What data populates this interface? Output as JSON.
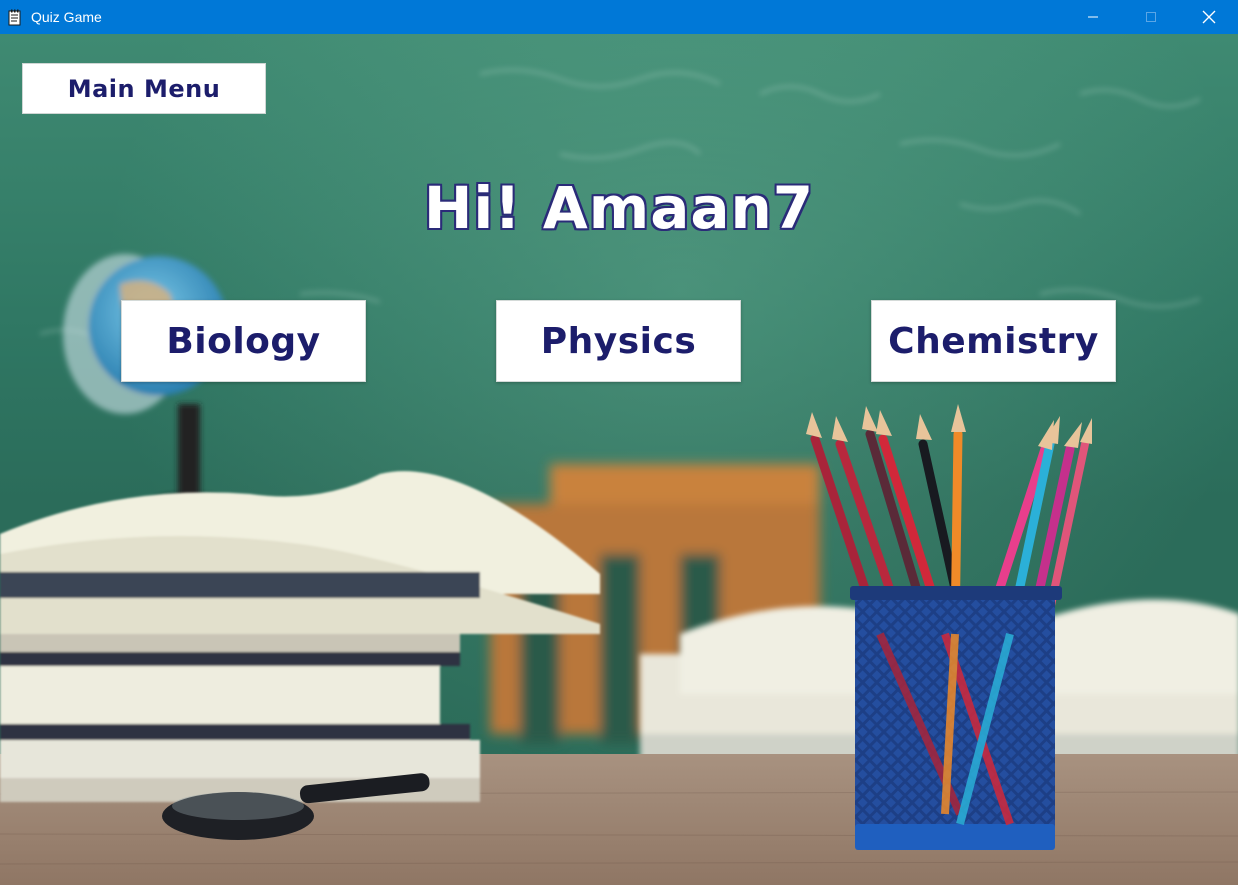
{
  "window": {
    "title": "Quiz Game",
    "controls": [
      "minimize-icon",
      "maximize-icon",
      "close-icon"
    ],
    "titlebar_color": "#0078d7"
  },
  "main_menu_label": "Main Menu",
  "greeting": "Hi! Amaan7",
  "subjects": [
    {
      "label": "Biology"
    },
    {
      "label": "Physics"
    },
    {
      "label": "Chemistry"
    }
  ],
  "colors": {
    "button_text": "#1c1d6b",
    "greeting_outline": "#2a2b78",
    "chalkboard": "#2f7763"
  }
}
